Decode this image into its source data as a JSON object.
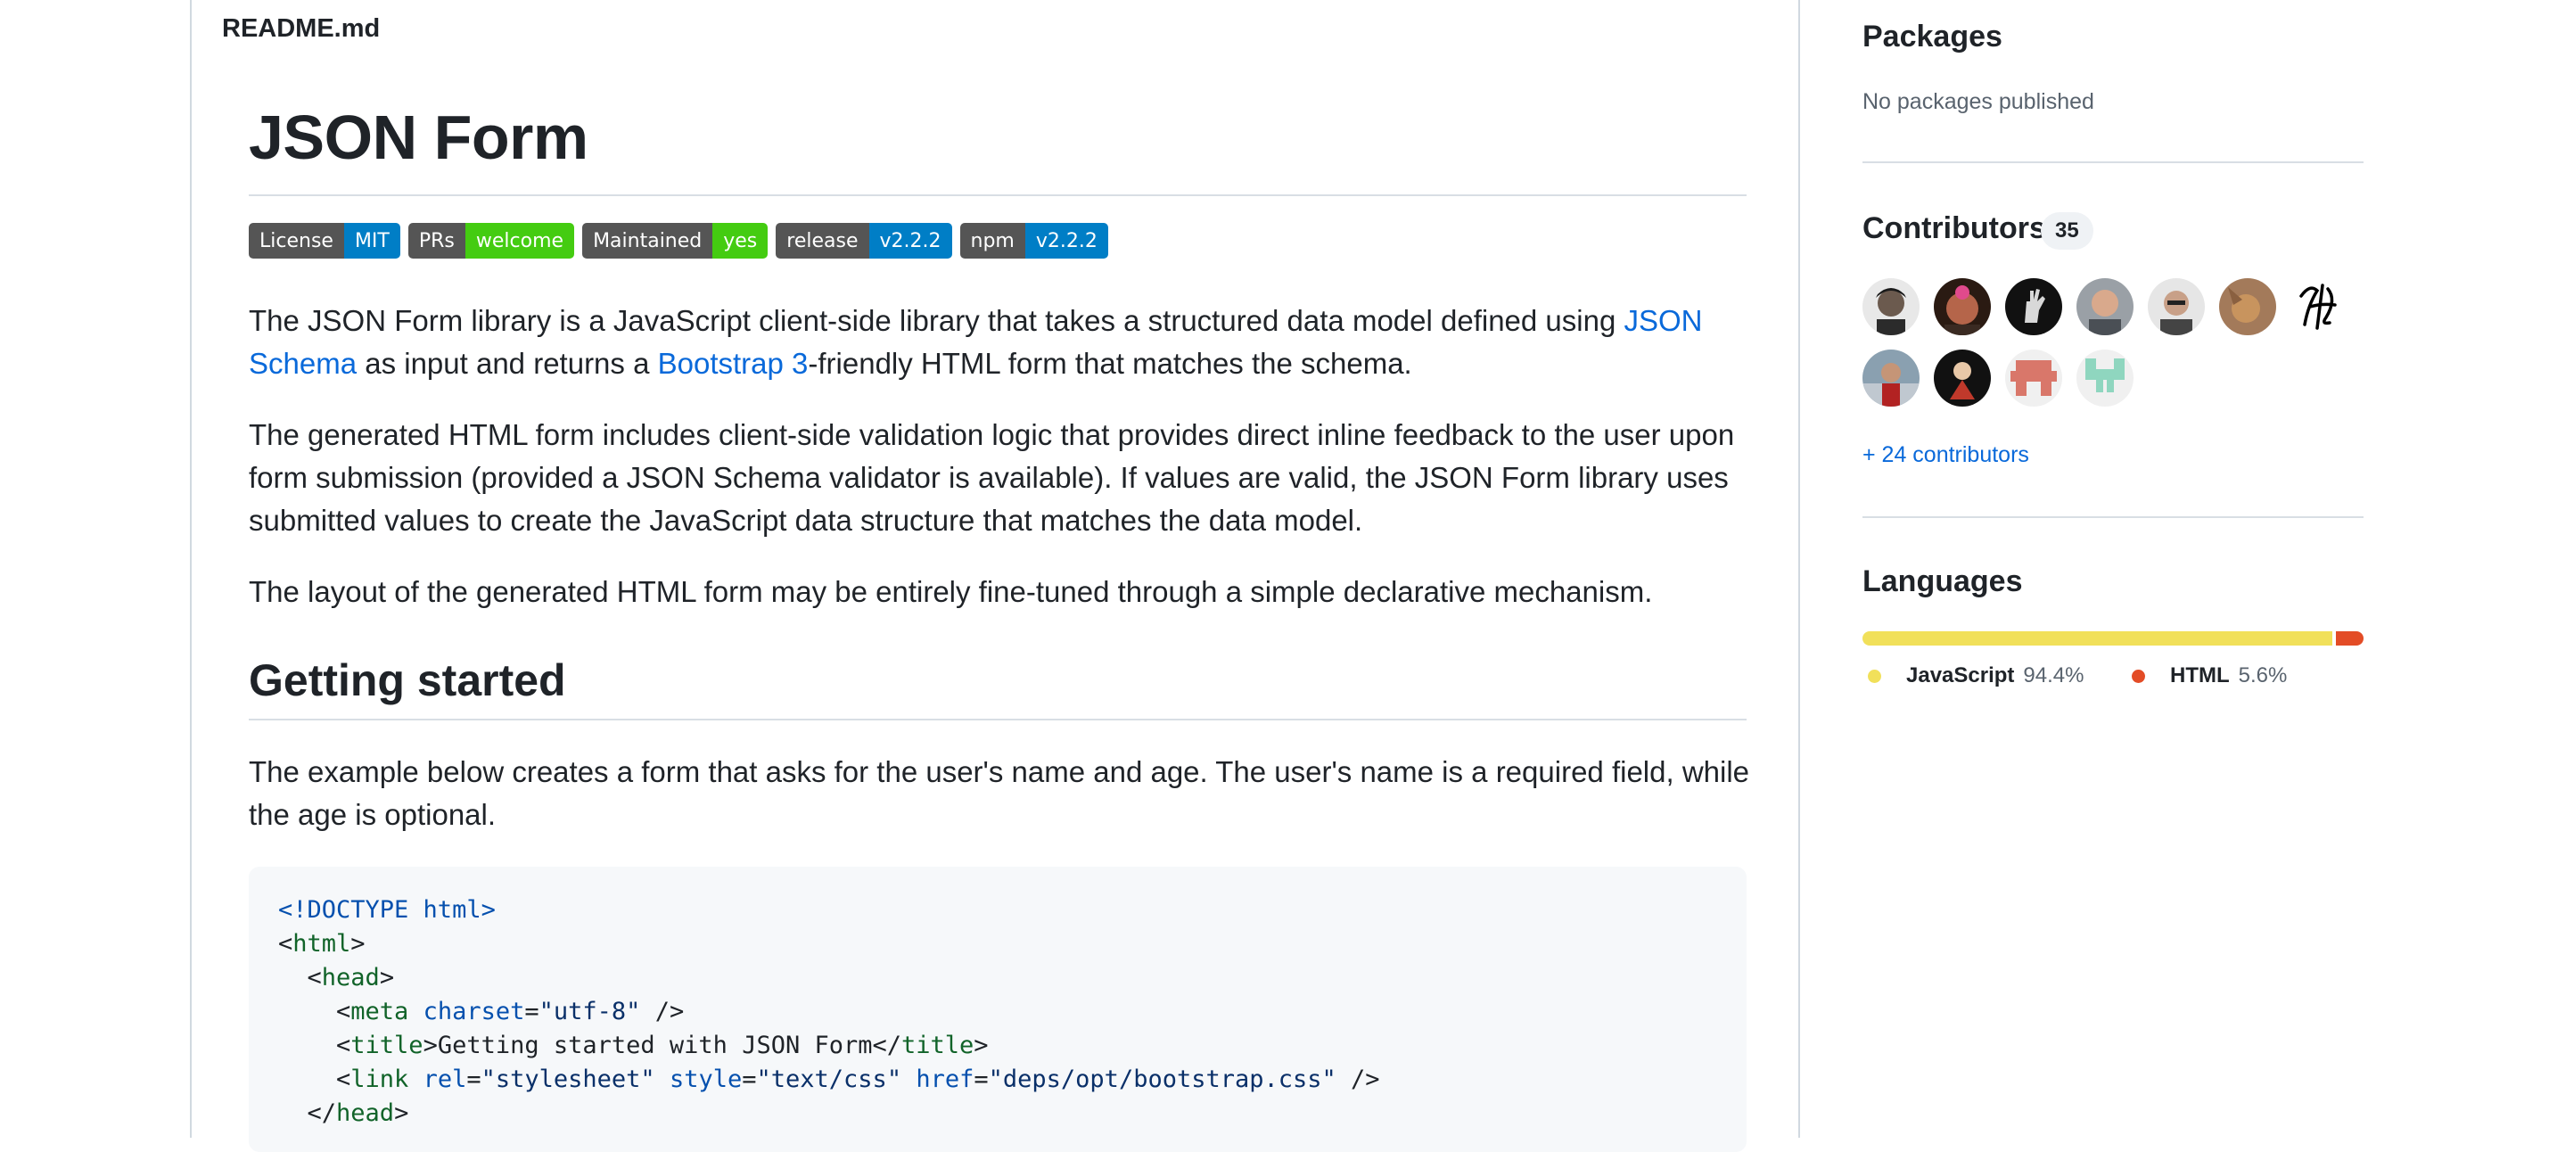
{
  "readme": {
    "filename": "README.md",
    "title": "JSON Form",
    "badges": [
      {
        "key": "License",
        "value": "MIT",
        "color": "#007ec6"
      },
      {
        "key": "PRs",
        "value": "welcome",
        "color": "#4c1"
      },
      {
        "key": "Maintained",
        "value": "yes",
        "color": "#4c1"
      },
      {
        "key": "release",
        "value": "v2.2.2",
        "color": "#007ec6"
      },
      {
        "key": "npm",
        "value": "v2.2.2",
        "color": "#007ec6"
      }
    ],
    "intro": {
      "text1": "The JSON Form library is a JavaScript client-side library that takes a structured data model defined using ",
      "link1_line1": "JSON",
      "link1_line2": "Schema",
      "text2": " as input and returns a ",
      "link2": "Bootstrap 3",
      "text3": "-friendly HTML form that matches the schema."
    },
    "para2": "The generated HTML form includes client-side validation logic that provides direct inline feedback to the user upon form submission (provided a JSON Schema validator is available). If values are valid, the JSON Form library uses submitted values to create the JavaScript data structure that matches the data model.",
    "para3": "The layout of the generated HTML form may be entirely fine-tuned through a simple declarative mechanism.",
    "section_title": "Getting started",
    "section_para": "The example below creates a form that asks for the user's name and age. The user's name is a required field, while the age is optional.",
    "code": {
      "doctype": "<!DOCTYPE html>",
      "html_tag": "html",
      "head_tag": "head",
      "meta_tag": "meta",
      "meta_attr": "charset",
      "meta_val": "\"utf-8\"",
      "title_tag": "title",
      "title_text": "Getting started with JSON Form",
      "link_tag": "link",
      "link_attr1": "rel",
      "link_val1": "\"stylesheet\"",
      "link_attr2": "style",
      "link_val2": "\"text/css\"",
      "link_attr3": "href",
      "link_val3": "\"deps/opt/bootstrap.css\""
    }
  },
  "sidebar": {
    "packages_title": "Packages",
    "packages_text": "No packages published",
    "contributors_title": "Contributors",
    "contributors_count": "35",
    "contributors_link": "+ 24 contributors",
    "languages_title": "Languages",
    "languages": [
      {
        "name": "JavaScript",
        "percent": "94.4%",
        "value": 94.4,
        "color": "#f1e05a"
      },
      {
        "name": "HTML",
        "percent": "5.6%",
        "value": 5.6,
        "color": "#e34c26"
      }
    ]
  }
}
